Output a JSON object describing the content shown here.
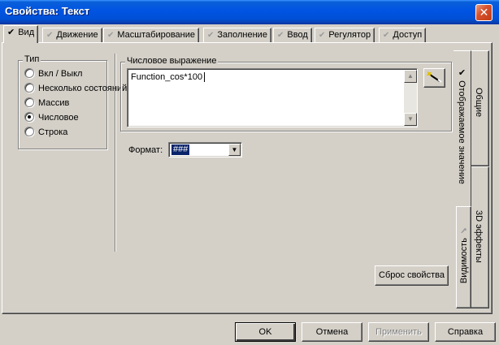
{
  "window": {
    "title": "Свойства: Текст",
    "close_glyph": "✕"
  },
  "tabs": [
    {
      "label": "Вид",
      "icon": "check-icon",
      "active": true
    },
    {
      "label": "Движение",
      "icon": "check-icon"
    },
    {
      "label": "Масштабирование",
      "icon": "check-icon"
    },
    {
      "label": "Заполнение",
      "icon": "check-icon"
    },
    {
      "label": "Ввод",
      "icon": "check-icon"
    },
    {
      "label": "Регулятор",
      "icon": "check-icon"
    },
    {
      "label": "Доступ",
      "icon": "check-icon"
    }
  ],
  "type_group": {
    "legend": "Тип",
    "options": [
      {
        "label": "Вкл / Выкл",
        "selected": false
      },
      {
        "label": "Несколько состояний",
        "selected": false
      },
      {
        "label": "Массив",
        "selected": false
      },
      {
        "label": "Числовое",
        "selected": true
      },
      {
        "label": "Строка",
        "selected": false
      }
    ]
  },
  "expression_group": {
    "legend": "Числовое выражение",
    "value": "Function_cos*100"
  },
  "format": {
    "label": "Формат:",
    "value": "###"
  },
  "reset_button": {
    "label": "Сброс свойства"
  },
  "side_tabs": [
    {
      "label": "Общие"
    },
    {
      "label": "Отображаемое значение",
      "active": true
    },
    {
      "label": "3D эффекты"
    },
    {
      "label": "Видимость"
    }
  ],
  "dialog_buttons": {
    "ok": "OK",
    "cancel": "Отмена",
    "apply": "Применить",
    "help": "Справка"
  },
  "colors": {
    "titlebar": "#0054e3",
    "face": "#d4d0c8",
    "selection": "#0a246a",
    "close": "#c23c14"
  }
}
